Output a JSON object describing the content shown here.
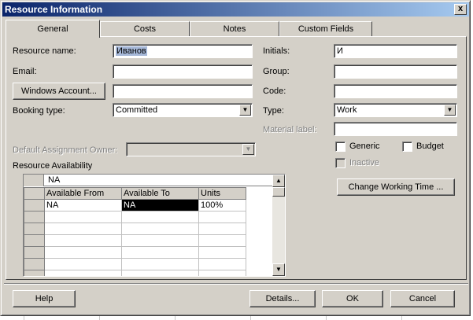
{
  "window": {
    "title": "Resource Information",
    "close_glyph": "x"
  },
  "tabs": [
    {
      "label": "General",
      "active": true
    },
    {
      "label": "Costs",
      "active": false
    },
    {
      "label": "Notes",
      "active": false
    },
    {
      "label": "Custom Fields",
      "active": false
    }
  ],
  "form": {
    "resource_name_label": "Resource name:",
    "resource_name_value": "Иванов",
    "email_label": "Email:",
    "email_value": "",
    "windows_account_button": "Windows Account...",
    "windows_account_value": "",
    "booking_type_label": "Booking type:",
    "booking_type_value": "Committed",
    "default_owner_label": "Default Assignment Owner:",
    "default_owner_value": "",
    "initials_label": "Initials:",
    "initials_value": "И",
    "group_label": "Group:",
    "group_value": "",
    "code_label": "Code:",
    "code_value": "",
    "type_label": "Type:",
    "type_value": "Work",
    "material_label_label": "Material label:",
    "material_label_value": "",
    "generic_label": "Generic",
    "generic_checked": false,
    "budget_label": "Budget",
    "budget_checked": false,
    "inactive_label": "Inactive",
    "inactive_checked": false,
    "change_working_time_button": "Change Working Time ..."
  },
  "availability": {
    "label": "Resource Availability",
    "entry_value": "NA",
    "columns": [
      "Available From",
      "Available To",
      "Units"
    ],
    "rows": [
      [
        "NA",
        "NA",
        "100%"
      ],
      [
        "",
        "",
        ""
      ],
      [
        "",
        "",
        ""
      ],
      [
        "",
        "",
        ""
      ],
      [
        "",
        "",
        ""
      ],
      [
        "",
        "",
        ""
      ],
      [
        "",
        "",
        ""
      ]
    ]
  },
  "footer": {
    "help_button": "Help",
    "details_button": "Details...",
    "ok_button": "OK",
    "cancel_button": "Cancel"
  },
  "icons": {
    "dropdown_arrow": "▼",
    "scroll_up": "▲",
    "scroll_down": "▼"
  },
  "colors": {
    "dialog_bg": "#d4d0c8",
    "title_start": "#0a246a",
    "title_end": "#a6caf0",
    "selection_bg": "#000000"
  }
}
